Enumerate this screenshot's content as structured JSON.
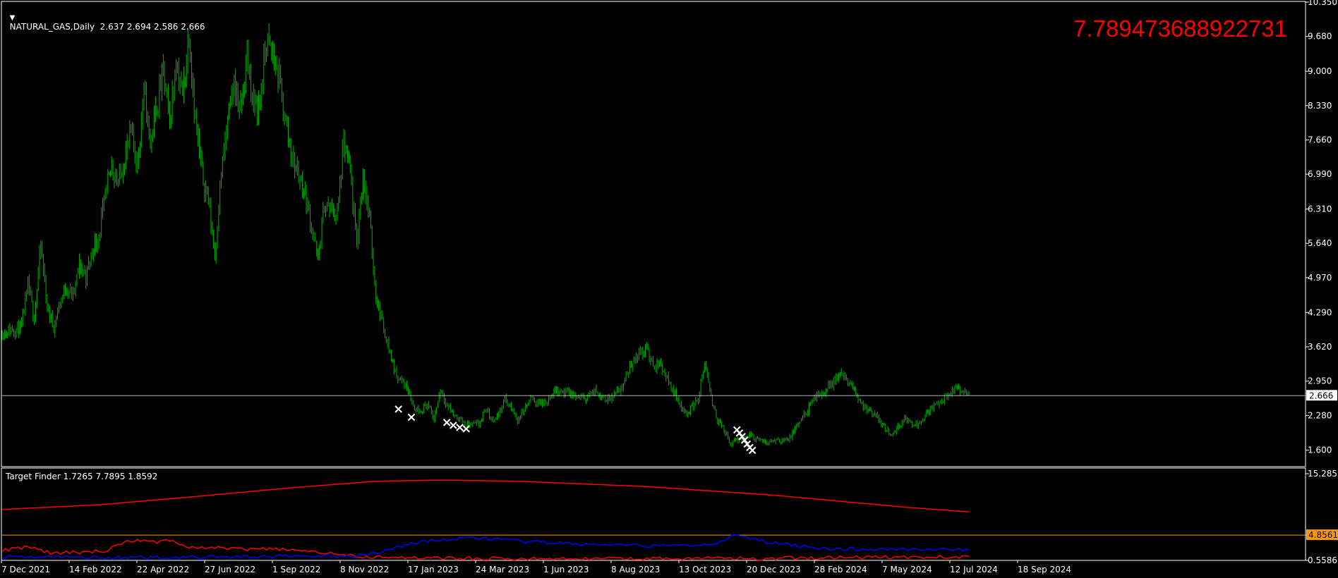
{
  "window": {
    "symbol_header": "NATURAL_GAS,Daily  2.637 2.694 2.586 2.666",
    "overlay_value": "7.789473688922731"
  },
  "colors": {
    "background": "#000000",
    "candles": "#00b400",
    "markers": "#ffffff",
    "red_line": "#ff0000",
    "blue_line": "#0000ff",
    "level_line": "#ff9900",
    "current_price_line": "#b4b4b4",
    "text": "#ffffff",
    "overlay_text": "#ff0000"
  },
  "chart_data": [
    {
      "type": "ohlc",
      "symbol": "NATURAL_GAS",
      "timeframe": "Daily",
      "last_bar": {
        "open": 2.637,
        "high": 2.694,
        "low": 2.586,
        "close": 2.666
      },
      "y_ticks": [
        "10.350",
        "9.680",
        "9.000",
        "8.330",
        "7.660",
        "6.990",
        "6.310",
        "5.640",
        "4.970",
        "4.290",
        "3.620",
        "2.950",
        "2.280",
        "1.600"
      ],
      "ylim": [
        1.28,
        10.35
      ],
      "current_price": "2.666",
      "x_ticks": [
        "7 Dec 2021",
        "14 Feb 2022",
        "22 Apr 2022",
        "27 Jun 2022",
        "1 Sep 2022",
        "8 Nov 2022",
        "17 Jan 2023",
        "24 Mar 2023",
        "1 Jun 2023",
        "8 Aug 2023",
        "13 Oct 2023",
        "20 Dec 2023",
        "28 Feb 2024",
        "7 May 2024",
        "12 Jul 2024",
        "18 Sep 2024"
      ],
      "x_range_weeks": [
        0,
        202
      ],
      "close_path": [
        [
          0,
          3.9
        ],
        [
          3,
          4.0
        ],
        [
          4,
          4.8
        ],
        [
          5,
          4.2
        ],
        [
          6,
          5.6
        ],
        [
          7,
          4.4
        ],
        [
          8,
          4.0
        ],
        [
          9,
          4.5
        ],
        [
          10,
          4.8
        ],
        [
          11,
          4.6
        ],
        [
          12,
          5.2
        ],
        [
          13,
          5.0
        ],
        [
          14,
          5.5
        ],
        [
          15,
          5.8
        ],
        [
          16,
          6.5
        ],
        [
          17,
          7.2
        ],
        [
          18,
          6.8
        ],
        [
          20,
          7.8
        ],
        [
          21,
          7.2
        ],
        [
          22,
          8.6
        ],
        [
          23,
          7.6
        ],
        [
          24,
          8.3
        ],
        [
          25,
          9.0
        ],
        [
          26,
          8.0
        ],
        [
          27,
          9.2
        ],
        [
          28,
          8.5
        ],
        [
          29,
          9.8
        ],
        [
          30,
          8.0
        ],
        [
          31,
          7.0
        ],
        [
          32,
          6.5
        ],
        [
          33,
          5.4
        ],
        [
          34,
          7.0
        ],
        [
          35,
          8.0
        ],
        [
          36,
          8.8
        ],
        [
          37,
          8.2
        ],
        [
          38,
          9.3
        ],
        [
          39,
          8.3
        ],
        [
          40,
          8.4
        ],
        [
          41,
          9.6
        ],
        [
          42,
          9.3
        ],
        [
          43,
          8.8
        ],
        [
          44,
          8.0
        ],
        [
          45,
          7.3
        ],
        [
          46,
          7.0
        ],
        [
          47,
          6.6
        ],
        [
          48,
          6.0
        ],
        [
          49,
          5.3
        ],
        [
          50,
          6.4
        ],
        [
          52,
          6.2
        ],
        [
          53,
          7.6
        ],
        [
          54,
          7.0
        ],
        [
          55,
          5.6
        ],
        [
          56,
          7.0
        ],
        [
          57,
          6.1
        ],
        [
          58,
          4.6
        ],
        [
          59,
          4.1
        ],
        [
          60,
          3.6
        ],
        [
          61,
          3.1
        ],
        [
          63,
          2.8
        ],
        [
          64,
          2.4
        ],
        [
          65,
          2.4
        ],
        [
          66,
          2.5
        ],
        [
          67,
          2.2
        ],
        [
          68,
          2.8
        ],
        [
          69,
          2.5
        ],
        [
          70,
          2.3
        ],
        [
          71,
          2.2
        ],
        [
          72,
          2.1
        ],
        [
          74,
          2.1
        ],
        [
          75,
          2.4
        ],
        [
          76,
          2.2
        ],
        [
          77,
          2.3
        ],
        [
          78,
          2.6
        ],
        [
          80,
          2.2
        ],
        [
          82,
          2.6
        ],
        [
          84,
          2.5
        ],
        [
          86,
          2.8
        ],
        [
          88,
          2.7
        ],
        [
          90,
          2.6
        ],
        [
          92,
          2.75
        ],
        [
          94,
          2.6
        ],
        [
          96,
          2.8
        ],
        [
          98,
          3.4
        ],
        [
          100,
          3.6
        ],
        [
          101,
          3.2
        ],
        [
          102,
          3.3
        ],
        [
          104,
          2.8
        ],
        [
          106,
          2.3
        ],
        [
          108,
          2.6
        ],
        [
          109,
          3.3
        ],
        [
          110,
          2.6
        ],
        [
          111,
          2.2
        ],
        [
          112,
          2.0
        ],
        [
          113,
          1.7
        ],
        [
          114,
          1.8
        ],
        [
          116,
          1.9
        ],
        [
          118,
          1.75
        ],
        [
          120,
          1.8
        ],
        [
          122,
          1.8
        ],
        [
          124,
          2.2
        ],
        [
          126,
          2.6
        ],
        [
          128,
          2.8
        ],
        [
          130,
          3.1
        ],
        [
          132,
          2.8
        ],
        [
          134,
          2.4
        ],
        [
          136,
          2.2
        ],
        [
          138,
          1.9
        ],
        [
          140,
          2.2
        ],
        [
          142,
          2.1
        ],
        [
          144,
          2.4
        ],
        [
          146,
          2.6
        ],
        [
          148,
          2.8
        ],
        [
          150,
          2.666
        ]
      ],
      "markers": {
        "symbol": "×",
        "points": [
          [
            61.5,
            2.41
          ],
          [
            63.5,
            2.25
          ],
          [
            69,
            2.15
          ],
          [
            70,
            2.09
          ],
          [
            71,
            2.05
          ],
          [
            72,
            2.02
          ],
          [
            114,
            2.0
          ],
          [
            114.4,
            1.94
          ],
          [
            114.8,
            1.87
          ],
          [
            115.2,
            1.8
          ],
          [
            115.6,
            1.73
          ],
          [
            116,
            1.66
          ],
          [
            116.4,
            1.6
          ]
        ]
      }
    },
    {
      "type": "line",
      "title": "Target Finder 1.7265 7.7895 1.8592",
      "y_ticks": [
        "15.2857",
        "4.8561",
        "0.5586"
      ],
      "ylim": [
        0.5586,
        15.2857
      ],
      "level": "4.8561",
      "series": [
        {
          "color": "red",
          "points": [
            [
              0,
              9.2
            ],
            [
              15,
              10.0
            ],
            [
              30,
              11.4
            ],
            [
              45,
              12.9
            ],
            [
              58,
              14.0
            ],
            [
              68,
              14.2
            ],
            [
              80,
              14.0
            ],
            [
              100,
              13.1
            ],
            [
              120,
              11.6
            ],
            [
              140,
              9.6
            ],
            [
              150,
              8.8
            ]
          ]
        },
        {
          "color": "red",
          "points": [
            [
              0,
              2.3
            ],
            [
              4,
              2.8
            ],
            [
              8,
              1.7
            ],
            [
              16,
              2.2
            ],
            [
              20,
              3.9
            ],
            [
              24,
              3.6
            ],
            [
              26,
              4.0
            ],
            [
              30,
              2.5
            ],
            [
              34,
              2.8
            ],
            [
              38,
              2.3
            ],
            [
              42,
              2.6
            ],
            [
              46,
              2.0
            ],
            [
              50,
              1.8
            ],
            [
              56,
              1.2
            ],
            [
              60,
              1.0
            ],
            [
              70,
              0.9
            ],
            [
              100,
              0.9
            ],
            [
              120,
              0.9
            ],
            [
              150,
              1.2
            ]
          ]
        },
        {
          "color": "blue",
          "points": [
            [
              0,
              1.2
            ],
            [
              20,
              1.0
            ],
            [
              40,
              1.2
            ],
            [
              56,
              1.4
            ],
            [
              60,
              2.4
            ],
            [
              64,
              3.6
            ],
            [
              70,
              4.2
            ],
            [
              74,
              4.4
            ],
            [
              80,
              3.8
            ],
            [
              90,
              3.3
            ],
            [
              100,
              3.0
            ],
            [
              106,
              3.1
            ],
            [
              110,
              3.4
            ],
            [
              114,
              4.8
            ],
            [
              118,
              3.8
            ],
            [
              122,
              3.2
            ],
            [
              126,
              2.8
            ],
            [
              130,
              2.4
            ],
            [
              140,
              2.5
            ],
            [
              150,
              2.3
            ]
          ]
        }
      ]
    }
  ]
}
